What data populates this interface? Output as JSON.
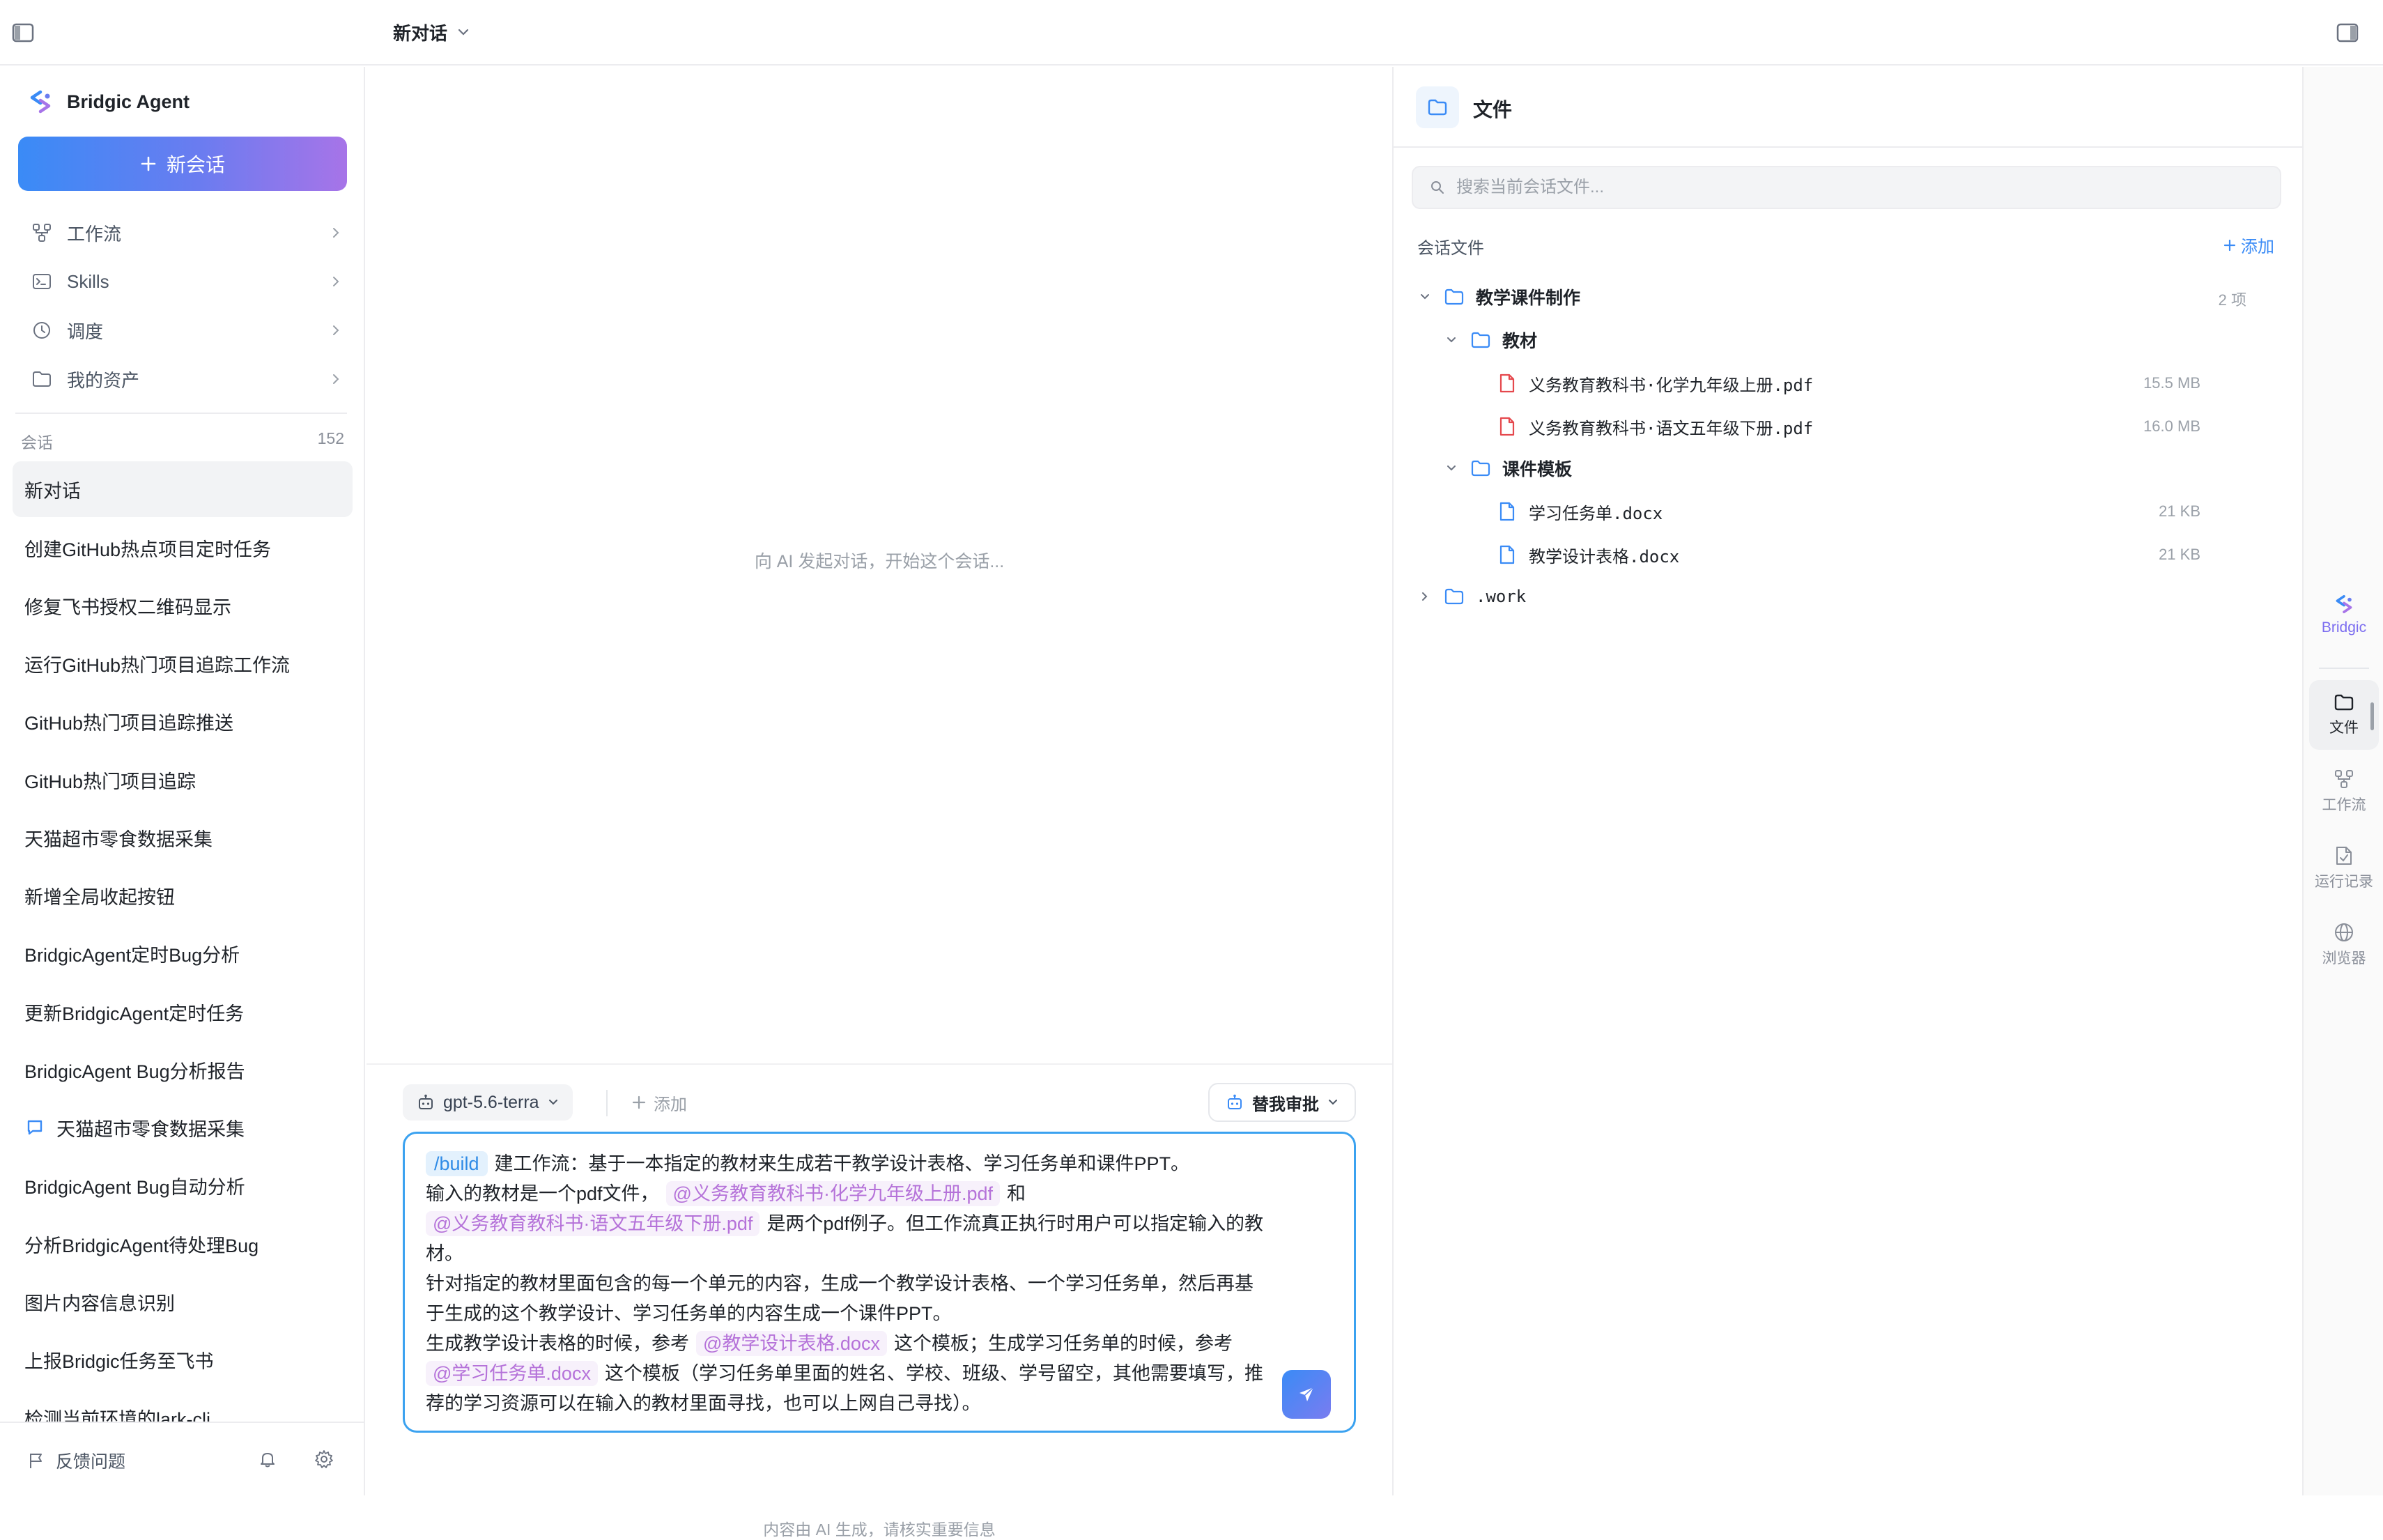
{
  "topbar": {
    "conversation_title": "新对话"
  },
  "sidebar": {
    "brand": "Bridgic Agent",
    "new_chat_label": "新会话",
    "nav": [
      {
        "label": "工作流",
        "icon": "workflow-icon"
      },
      {
        "label": "Skills",
        "icon": "terminal-icon"
      },
      {
        "label": "调度",
        "icon": "clock-icon"
      },
      {
        "label": "我的资产",
        "icon": "folder-icon"
      }
    ],
    "sessions_label": "会话",
    "sessions_count": "152",
    "sessions": [
      {
        "title": "新对话",
        "active": true
      },
      {
        "title": "创建GitHub热点项目定时任务"
      },
      {
        "title": "修复飞书授权二维码显示"
      },
      {
        "title": "运行GitHub热门项目追踪工作流"
      },
      {
        "title": "GitHub热门项目追踪推送"
      },
      {
        "title": "GitHub热门项目追踪"
      },
      {
        "title": "天猫超市零食数据采集"
      },
      {
        "title": "新增全局收起按钮"
      },
      {
        "title": "BridgicAgent定时Bug分析"
      },
      {
        "title": "更新BridgicAgent定时任务"
      },
      {
        "title": "BridgicAgent Bug分析报告"
      },
      {
        "title": "天猫超市零食数据采集",
        "icon": "chat-bubble-icon"
      },
      {
        "title": "BridgicAgent Bug自动分析"
      },
      {
        "title": "分析BridgicAgent待处理Bug"
      },
      {
        "title": "图片内容信息识别"
      },
      {
        "title": "上报Bridgic任务至飞书"
      },
      {
        "title": "检测当前环境的lark-cli"
      }
    ],
    "feedback_label": "反馈问题"
  },
  "chat": {
    "empty_hint": "向 AI 发起对话，开始这个会话...",
    "model": "gpt-5.6-terra",
    "add_label": "添加",
    "approval_label": "替我审批",
    "input": {
      "command": "/build",
      "line1": "建工作流：基于一本指定的教材来生成若干教学设计表格、学习任务单和课件PPT。",
      "line2a": "输入的教材是一个pdf文件，",
      "mention1": "@义务教育教科书·化学九年级上册.pdf",
      "line2b": "和",
      "mention2": "@义务教育教科书·语文五年级下册.pdf",
      "line3": "是两个pdf例子。但工作流真正执行时用户可以指定输入的教材。",
      "line4": "针对指定的教材里面包含的每一个单元的内容，生成一个教学设计表格、一个学习任务单，然后再基于生成的这个教学设计、学习任务单的内容生成一个课件PPT。",
      "line5a": "生成教学设计表格的时候，参考",
      "mention3": "@教学设计表格.docx",
      "line5b": "这个模板；生成学习任务单的时候，参考",
      "mention4": "@学习任务单.docx",
      "line6": "这个模板（学习任务单里面的姓名、学校、班级、学号留空，其他需要填写，推荐的学习资源可以在输入的教材里面寻找，也可以上网自己寻找）。"
    },
    "disclaimer": "内容由 AI 生成，请核实重要信息"
  },
  "files": {
    "title": "文件",
    "search_placeholder": "搜索当前会话文件...",
    "section_label": "会话文件",
    "add_label": "添加",
    "tree": {
      "root_name": "教学课件制作",
      "root_count": "2 项",
      "folder1": "教材",
      "file1": {
        "name": "义务教育教科书·化学九年级上册.pdf",
        "size": "15.5 MB"
      },
      "file2": {
        "name": "义务教育教科书·语文五年级下册.pdf",
        "size": "16.0 MB"
      },
      "folder2": "课件模板",
      "file3": {
        "name": "学习任务单.docx",
        "size": "21 KB"
      },
      "file4": {
        "name": "教学设计表格.docx",
        "size": "21 KB"
      },
      "hidden_folder": ".work"
    }
  },
  "rail": {
    "items": [
      {
        "label": "Bridgic",
        "icon": "bridgic-logo-icon"
      },
      {
        "label": "文件",
        "icon": "folder-icon",
        "active": true
      },
      {
        "label": "工作流",
        "icon": "workflow-icon"
      },
      {
        "label": "运行记录",
        "icon": "run-log-icon"
      },
      {
        "label": "浏览器",
        "icon": "globe-icon"
      }
    ]
  },
  "colors": {
    "accent": "#3a8bf6",
    "gradient_end": "#a774e8",
    "mention_text": "#b572d9",
    "pdf_icon": "#e5484d",
    "doc_icon": "#3a8bf6",
    "folder_icon": "#3a8bf6"
  }
}
